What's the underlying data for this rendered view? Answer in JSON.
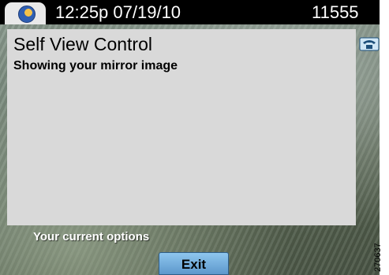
{
  "status_bar": {
    "datetime": "12:25p 07/19/10",
    "extension": "11555"
  },
  "panel": {
    "title": "Self View Control",
    "subtitle": "Showing your mirror image"
  },
  "options": {
    "label": "Your current options"
  },
  "softkeys": [
    {
      "label": "Exit"
    }
  ],
  "figure_id": "270637",
  "icons": {
    "tab_icon": "globe-icon",
    "line_icon": "phone-icon"
  },
  "colors": {
    "top_bar": "#000000",
    "panel": "#d9d9d9",
    "softkey": "#7fb8e6"
  }
}
